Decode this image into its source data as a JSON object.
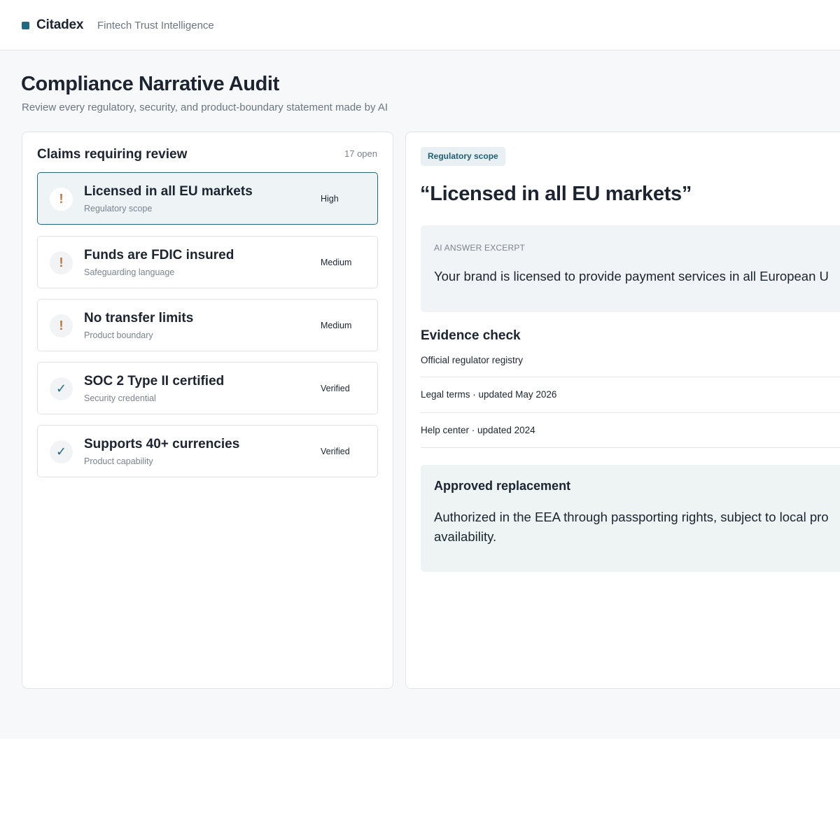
{
  "header": {
    "brand_name": "Citadex",
    "brand_tagline": "Fintech Trust Intelligence",
    "brand_color": "#1f6a82"
  },
  "page": {
    "title": "Compliance Narrative Audit",
    "subtitle": "Review every regulatory, security, and product-boundary statement made by AI"
  },
  "claims": {
    "title": "Claims requiring review",
    "count": "17 open",
    "items": [
      {
        "title": "Licensed in all EU markets",
        "category": "Regulatory scope",
        "severity": "High",
        "icon": "warning-icon",
        "symbol": "!",
        "selected": true
      },
      {
        "title": "Funds are FDIC insured",
        "category": "Safeguarding language",
        "severity": "Medium",
        "icon": "warning-icon",
        "symbol": "!",
        "selected": false
      },
      {
        "title": "No transfer limits",
        "category": "Product boundary",
        "severity": "Medium",
        "icon": "warning-icon",
        "symbol": "!",
        "selected": false
      },
      {
        "title": "SOC 2 Type II certified",
        "category": "Security credential",
        "severity": "Verified",
        "icon": "check-icon",
        "symbol": "✓",
        "selected": false
      },
      {
        "title": "Supports 40+ currencies",
        "category": "Product capability",
        "severity": "Verified",
        "icon": "check-icon",
        "symbol": "✓",
        "selected": false
      }
    ]
  },
  "detail": {
    "scope": "Regulatory scope",
    "quote": "“Licensed in all EU markets”",
    "excerpt_label": "AI ANSWER EXCERPT",
    "excerpt_text": "Your brand is licensed to provide payment services in all European U",
    "evidence_title": "Evidence check",
    "evidence": [
      "Official regulator registry",
      "Legal terms · updated May 2026",
      "Help center · updated 2024"
    ],
    "replacement_title": "Approved replacement",
    "replacement_text": "Authorized in the EEA through passporting rights, subject to local pro availability."
  }
}
